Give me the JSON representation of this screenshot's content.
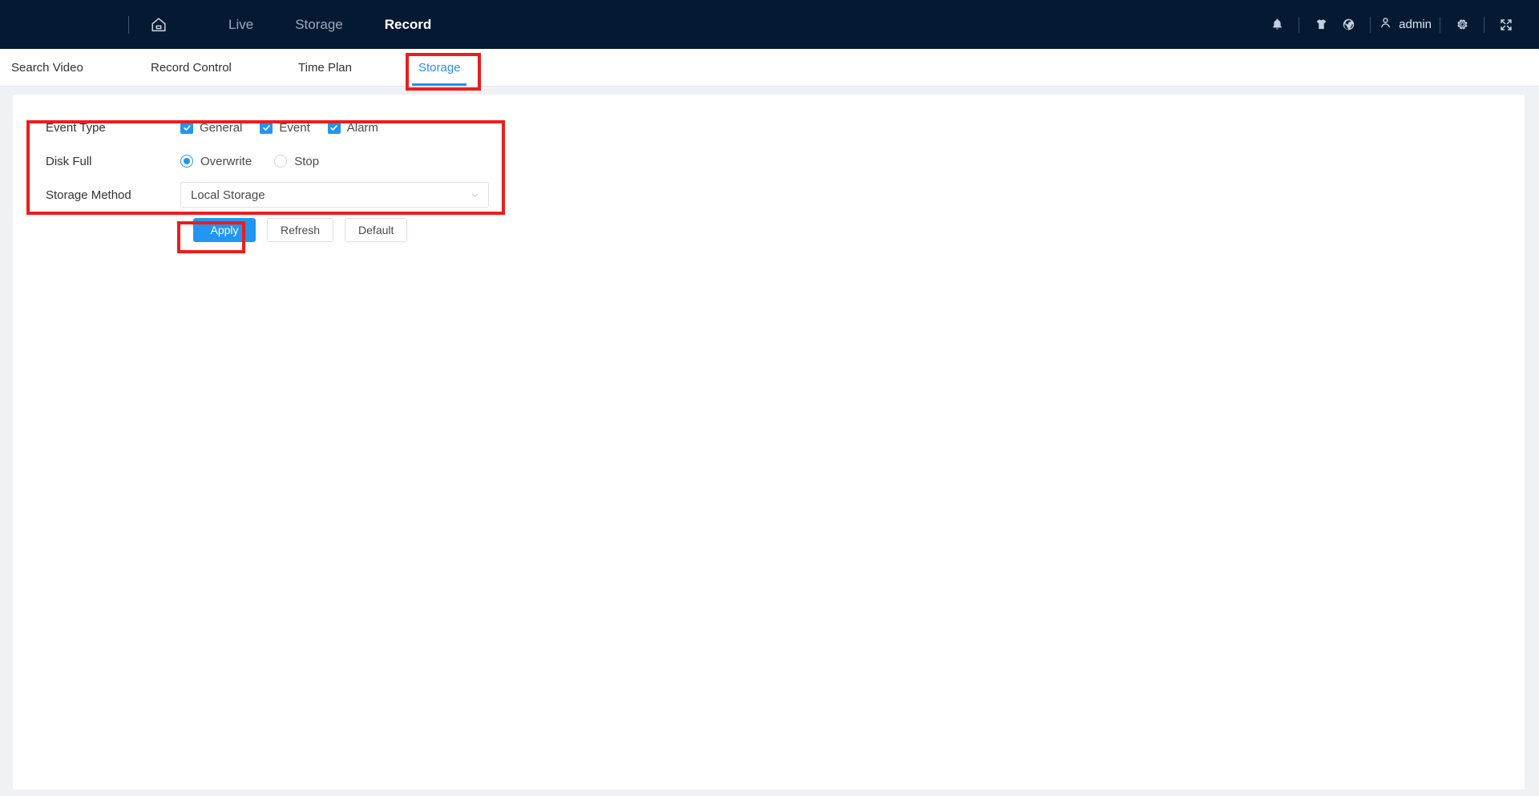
{
  "header": {
    "home_icon": "home-icon",
    "nav": [
      {
        "label": "Live",
        "active": false
      },
      {
        "label": "Storage",
        "active": false
      },
      {
        "label": "Record",
        "active": true
      }
    ],
    "right_icons": [
      {
        "name": "bell-icon"
      },
      {
        "name": "shirt-icon"
      },
      {
        "name": "globe-icon"
      },
      {
        "name": "user-icon"
      },
      {
        "name": "gear-icon"
      },
      {
        "name": "fullscreen-icon"
      }
    ],
    "user_label": "admin",
    "bg_color": "#051a32"
  },
  "subnav": {
    "tabs": [
      {
        "label": "Search Video",
        "active": false
      },
      {
        "label": "Record Control",
        "active": false
      },
      {
        "label": "Time Plan",
        "active": false
      },
      {
        "label": "Storage",
        "active": true
      }
    ],
    "active_color": "#2d8cf0"
  },
  "form": {
    "event_type": {
      "label": "Event Type",
      "options": [
        {
          "label": "General",
          "checked": true
        },
        {
          "label": "Event",
          "checked": true
        },
        {
          "label": "Alarm",
          "checked": true
        }
      ]
    },
    "disk_full": {
      "label": "Disk Full",
      "options": [
        {
          "label": "Overwrite",
          "checked": true
        },
        {
          "label": "Stop",
          "checked": false
        }
      ]
    },
    "storage_method": {
      "label": "Storage Method",
      "value": "Local Storage",
      "arrow_icon": "chevron-down-icon"
    }
  },
  "buttons": {
    "apply": "Apply",
    "refresh": "Refresh",
    "default": "Default",
    "primary_color": "#2196f3"
  },
  "annotations": {
    "highlight_color": "#ee1c1c",
    "boxes": [
      {
        "name": "storage-tab-highlight"
      },
      {
        "name": "form-highlight"
      },
      {
        "name": "apply-button-highlight"
      }
    ]
  }
}
